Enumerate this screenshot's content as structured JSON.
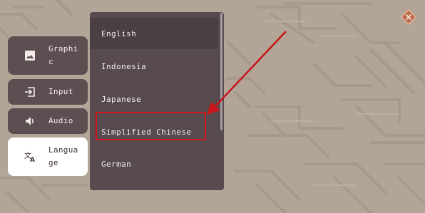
{
  "sidebar": {
    "items": [
      {
        "label": "Graphic",
        "icon": "image-icon"
      },
      {
        "label": "Input",
        "icon": "input-icon"
      },
      {
        "label": "Audio",
        "icon": "speaker-icon"
      },
      {
        "label": "Language",
        "icon": "translate-icon"
      }
    ],
    "active_index": 3
  },
  "language_dropdown": {
    "options": [
      "English",
      "Indonesia",
      "Japanese",
      "Simplified Chinese",
      "German"
    ],
    "selected": "English",
    "highlighted": "Simplified Chinese"
  },
  "colors": {
    "annotation": "#c8141a",
    "panel": "#574b50",
    "button": "#5c4e51",
    "background": "#b2a597"
  }
}
